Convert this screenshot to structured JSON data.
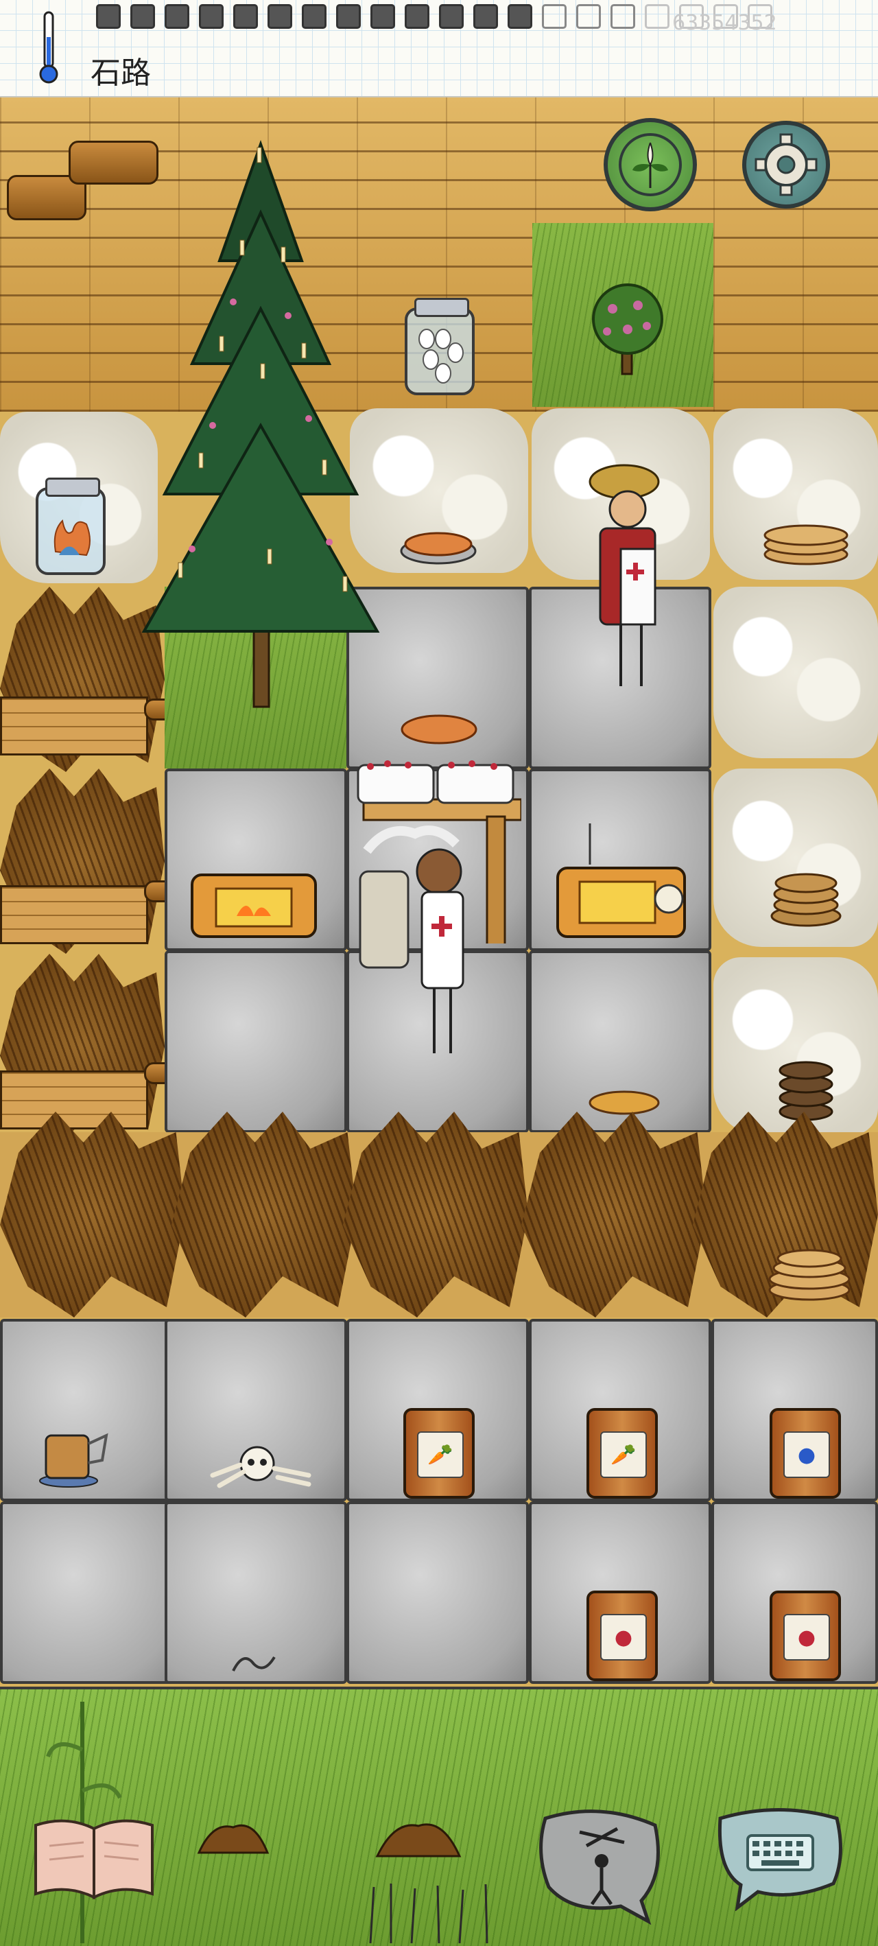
{
  "hud": {
    "place_label": "石路",
    "coordinates_text": "63354352",
    "temperature_icon": "thermometer-icon",
    "food_pips": {
      "total": 20,
      "filled": 13,
      "empty": 3,
      "faint": 4
    }
  },
  "buttons": {
    "map_icon": "compass-plant-icon",
    "settings_icon": "gear-icon",
    "book_icon": "open-book-icon",
    "emote_icon": "puppet-speech-icon",
    "keyboard_icon": "keyboard-speech-icon"
  },
  "colors": {
    "wood_floor": "#d9b25c",
    "stone_floor": "#b0b0b0",
    "grass": "#7aa83a",
    "button_teal": "#4f7a78",
    "button_green": "#5a9a4a"
  },
  "scene_objects": {
    "christmas_tree": "decorated-pine-tree",
    "bush": "gooseberry-bush",
    "jars": [
      "eggs-jar",
      "fire-jar"
    ],
    "crocks": [
      "carrot-crock",
      "carrot-crock",
      "blueberry-crock",
      "berry-crock",
      "berry-crock"
    ],
    "characters": [
      "nurse-player-with-feather-headdress",
      "old-man-nurse-with-straw-hat"
    ],
    "items": [
      "carrot-pie",
      "cakes-on-table",
      "oven-left",
      "oven-right",
      "bread-plate",
      "skeleton",
      "mug",
      "dirt-piles",
      "corn-stalk",
      "wheat"
    ]
  }
}
